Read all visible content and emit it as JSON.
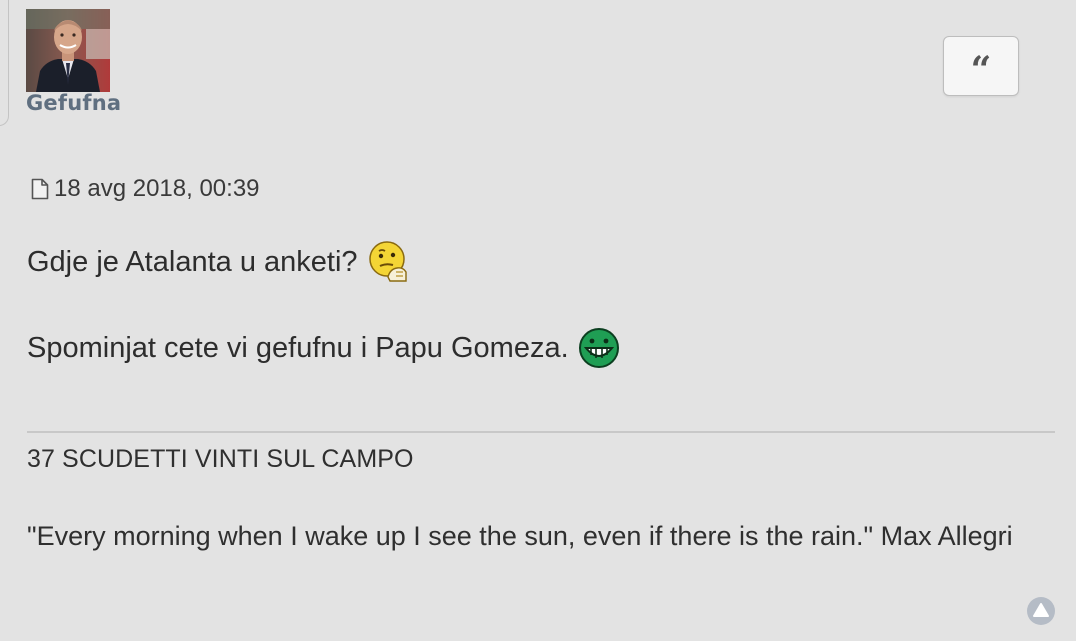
{
  "author": {
    "username": "Gefufna",
    "avatar_icon": "avatar-photo"
  },
  "quote_button": {
    "icon": "quote-icon",
    "glyph": "“"
  },
  "post": {
    "timestamp": "18 avg 2018, 00:39",
    "timestamp_icon": "post-icon",
    "lines": [
      {
        "text": "Gdje je Atalanta u anketi?",
        "emoji": "thinking-smiley-icon"
      },
      {
        "text": "Spominjat cete vi gefufnu i Papu Gomeza.",
        "emoji": "grin-smiley-icon"
      }
    ]
  },
  "signature": {
    "title": "37 SCUDETTI VINTI SUL CAMPO",
    "quote": "\"Every morning when I wake up I see the sun, even if there is the rain.\" Max Allegri"
  },
  "scroll_top": {
    "icon": "back-to-top-icon"
  },
  "colors": {
    "background": "#e3e3e3",
    "username": "#5f6f80",
    "text": "#2d2d2d",
    "divider": "#c8c8c8",
    "top_icon": "#b5bcc6"
  }
}
